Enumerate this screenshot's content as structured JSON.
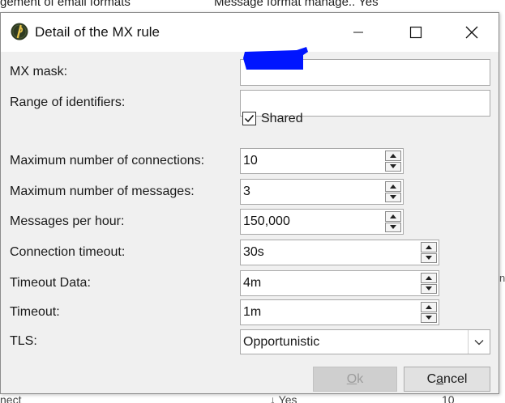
{
  "background": {
    "top_left_text": "gement of email formats",
    "top_right_text": "Message format manage.. Yes",
    "bottom_left_text": "nect",
    "bottom_mid_text": "↓ Yes",
    "bottom_right_text": "10",
    "edge_text": "n"
  },
  "dialog": {
    "title": "Detail of the MX rule",
    "icon": "app-logo-icon"
  },
  "fields": {
    "mx_mask": {
      "label": "MX mask:",
      "value": ""
    },
    "range": {
      "label": "Range of identifiers:",
      "value": ""
    },
    "shared": {
      "label": "Shared",
      "checked": true
    },
    "max_connections": {
      "label": "Maximum number of connections:",
      "value": "10"
    },
    "max_messages": {
      "label": "Maximum number of messages:",
      "value": "3"
    },
    "messages_per_hour": {
      "label": "Messages per hour:",
      "value": "150,000"
    },
    "connection_timeout": {
      "label": "Connection timeout:",
      "value": "30s"
    },
    "timeout_data": {
      "label": "Timeout Data:",
      "value": "4m"
    },
    "timeout": {
      "label": "Timeout:",
      "value": "1m"
    },
    "tls": {
      "label": "TLS:",
      "value": "Opportunistic"
    }
  },
  "buttons": {
    "ok": {
      "prefix": "",
      "mnemonic": "O",
      "rest": "k",
      "enabled": false
    },
    "cancel": {
      "prefix": "C",
      "mnemonic": "a",
      "rest": "ncel",
      "enabled": true
    }
  },
  "colors": {
    "redaction": "#0015ff",
    "dialog_bg": "#f0f0f0",
    "app_icon_bg": "#2f3b22",
    "app_icon_fg": "#e6c34a"
  }
}
